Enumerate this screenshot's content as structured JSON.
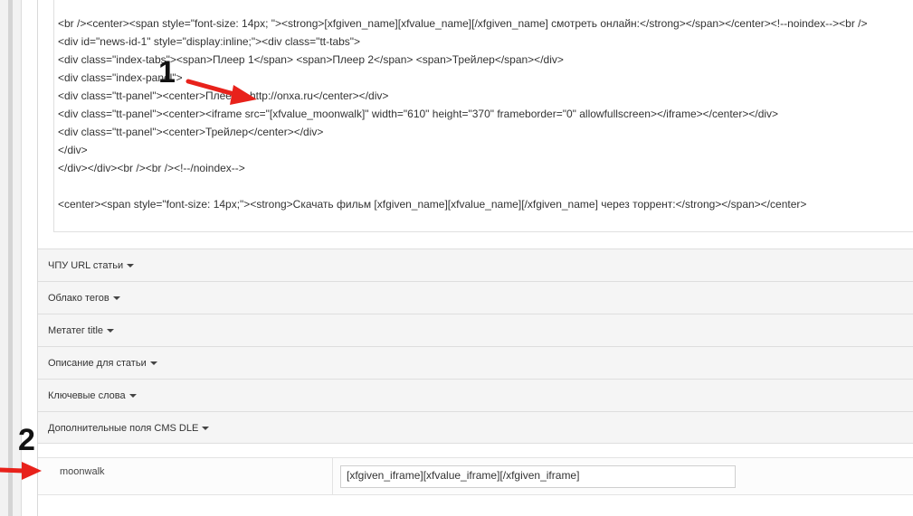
{
  "editor": {
    "lines": [
      "<br /><center><span style=\"font-size: 14px; \"><strong>[xfgiven_name][xfvalue_name][/xfgiven_name] смотреть онлайн:</strong></span></center><!--noindex--><br />",
      "<div id=\"news-id-1\" style=\"display:inline;\"><div class=\"tt-tabs\">",
      "<div class=\"index-tabs\"><span>Плеер 1</span> <span>Плеер 2</span> <span>Трейлер</span></div>",
      "<div class=\"index-panel\">",
      "<div class=\"tt-panel\"><center>Плеер 1 http://onxa.ru</center></div>",
      "<div class=\"tt-panel\"><center><iframe src=\"[xfvalue_moonwalk]\" width=\"610\" height=\"370\" frameborder=\"0\" allowfullscreen></iframe></center></div>",
      "<div class=\"tt-panel\"><center>Трейлер</center></div>",
      "</div>",
      "</div></div><br /><br /><!--/noindex-->",
      "",
      "<center><span style=\"font-size: 14px;\"><strong>Скачать фильм [xfgiven_name][xfvalue_name][/xfgiven_name] через торрент:</strong></span></center>"
    ]
  },
  "accordion": {
    "items": [
      {
        "label": "ЧПУ URL статьи"
      },
      {
        "label": "Облако тегов"
      },
      {
        "label": "Метатег title"
      },
      {
        "label": "Описание для статьи"
      },
      {
        "label": "Ключевые слова"
      },
      {
        "label": "Дополнительные поля CMS DLE"
      }
    ]
  },
  "fields": {
    "moonwalk": {
      "label": "moonwalk",
      "value": "[xfgiven_iframe][xfvalue_iframe][/xfgiven_iframe]"
    }
  },
  "annotations": {
    "marker_1": "1",
    "marker_2": "2",
    "arrow_color": "#e8221b"
  }
}
